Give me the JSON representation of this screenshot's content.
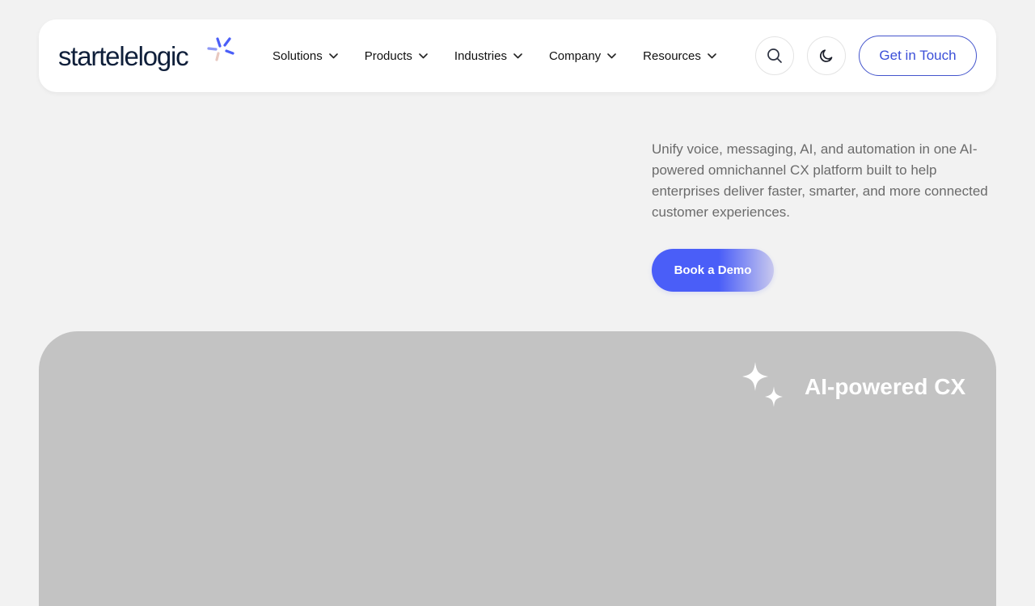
{
  "brand": {
    "logo_text": "startelelogic",
    "colors": {
      "accent": "#4a5ef8",
      "logo_text": "#0f1f3a",
      "cta_border": "#4455cc"
    }
  },
  "nav": {
    "items": [
      {
        "label": "Solutions"
      },
      {
        "label": "Products"
      },
      {
        "label": "Industries"
      },
      {
        "label": "Company"
      },
      {
        "label": "Resources"
      }
    ],
    "search_icon": "search-icon",
    "theme_icon": "moon-icon",
    "cta_label": "Get in Touch"
  },
  "hero": {
    "description": "Unify voice, messaging, AI, and automation in one AI-powered omnichannel CX platform built to help enterprises deliver faster, smarter, and more connected customer experiences.",
    "demo_button_label": "Book a Demo"
  },
  "media_panel": {
    "title": "AI-powered CX",
    "icon": "sparkle-icon"
  }
}
